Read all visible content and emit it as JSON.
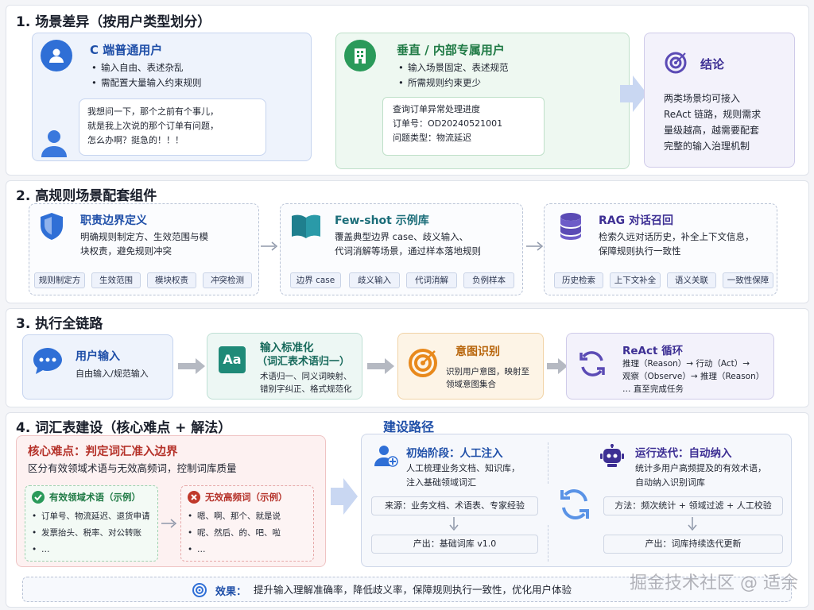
{
  "s1": {
    "title": "1. 场景差异（按用户类型划分）",
    "c_user": {
      "title": "C 端普通用户",
      "bullets": [
        "输入自由、表述杂乱",
        "需配置大量输入约束规则"
      ],
      "bubble": [
        "我想问一下，那个之前有个事儿，",
        "就是我上次说的那个订单有问题，",
        "怎么办啊？挺急的！！！"
      ]
    },
    "internal": {
      "title": "垂直 / 内部专属用户",
      "bullets": [
        "输入场景固定、表述规范",
        "所需规则约束更少"
      ],
      "box": [
        "查询订单异常处理进度",
        "订单号：OD20240521001",
        "问题类型：物流延迟"
      ]
    },
    "conclusion": {
      "title": "结论",
      "text": [
        "两类场景均可接入",
        "ReAct 链路，规则需求",
        "量级越高，越需要配套",
        "完整的输入治理机制"
      ]
    }
  },
  "s2": {
    "title": "2. 高规则场景配套组件",
    "cards": [
      {
        "title": "职责边界定义",
        "text": [
          "明确规则制定方、生效范围与模",
          "块权责，避免规则冲突"
        ],
        "tags": [
          "规则制定方",
          "生效范围",
          "模块权责",
          "冲突检测"
        ]
      },
      {
        "title": "Few-shot 示例库",
        "text": [
          "覆盖典型边界 case、歧义输入、",
          "代词消解等场景，通过样本落地规则"
        ],
        "tags": [
          "边界 case",
          "歧义输入",
          "代词消解",
          "负例样本"
        ]
      },
      {
        "title": "RAG 对话召回",
        "text": [
          "检索久远对话历史，补全上下文信息，",
          "保障规则执行一致性"
        ],
        "tags": [
          "历史检索",
          "上下文补全",
          "语义关联",
          "一致性保障"
        ]
      }
    ]
  },
  "s3": {
    "title": "3. 执行全链路",
    "steps": [
      {
        "title": "用户输入",
        "text": [
          "自由输入/规范输入"
        ]
      },
      {
        "title": "输入标准化",
        "subtitle": "（词汇表术语归一）",
        "text": [
          "术语归一、同义词映射、",
          "错别字纠正、格式规范化"
        ]
      },
      {
        "title": "意图识别",
        "text": [
          "识别用户意图，映射至",
          "领域意图集合"
        ]
      },
      {
        "title": "ReAct 循环",
        "text": [
          "推理（Reason）→ 行动（Act）→",
          "观察（Observe）→ 推理（Reason）",
          "… 直至完成任务"
        ]
      }
    ]
  },
  "s4": {
    "title": "4. 词汇表建设（核心难点 + 解法）",
    "difficulty": {
      "title": "核心难点：判定词汇准入边界",
      "subtitle": "区分有效领域术语与无效高频词，控制词库质量",
      "valid": {
        "title": "有效领域术语（示例）",
        "items": [
          "订单号、物流延迟、退货申请",
          "发票抬头、税率、对公转账",
          "…"
        ]
      },
      "invalid": {
        "title": "无效高频词（示例）",
        "items": [
          "嗯、啊、那个、就是说",
          "呢、然后、的、吧、啦",
          "…"
        ]
      }
    },
    "path": {
      "title": "建设路径",
      "stage1": {
        "title": "初始阶段：人工注入",
        "text": [
          "人工梳理业务文档、知识库，",
          "注入基础领域词汇"
        ],
        "source": "来源：业务文档、术语表、专家经验",
        "output": "产出：基础词库 v1.0"
      },
      "stage2": {
        "title": "运行迭代：自动纳入",
        "text": [
          "统计多用户高频提及的有效术语，",
          "自动纳入识别词库"
        ],
        "method": "方法：频次统计 + 领域过滤 + 人工校验",
        "output": "产出：词库持续迭代更新"
      }
    }
  },
  "effect": {
    "label": "效果：",
    "text": "提升输入理解准确率，降低歧义率，保障规则执行一致性，优化用户体验"
  },
  "watermark": "掘金技术社区 @ 适余",
  "colors": {
    "blue": "#2f6fd6",
    "green": "#2a9a5a",
    "orange": "#e8891c",
    "purple": "#5b4bb5",
    "red": "#c0392b"
  }
}
